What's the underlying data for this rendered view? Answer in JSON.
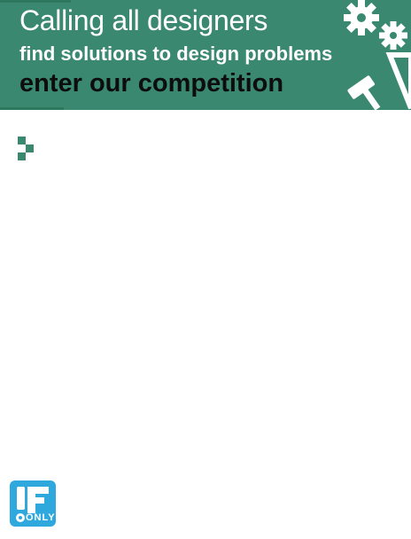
{
  "banner": {
    "headline": "Calling all designers",
    "subheadline": "find solutions to design problems",
    "call_to_action": "enter our competition",
    "background_color": "#3a8870",
    "illustration_icons": [
      "gear-icon",
      "gear-icon",
      "hammer-icon",
      "set-square-icon"
    ]
  },
  "content": {
    "bullet_icon": "stepped-square-icon",
    "accent_color": "#3a8870"
  },
  "logo": {
    "mark": "!F",
    "text": "ONLY",
    "background_color": "#2fa8de"
  }
}
